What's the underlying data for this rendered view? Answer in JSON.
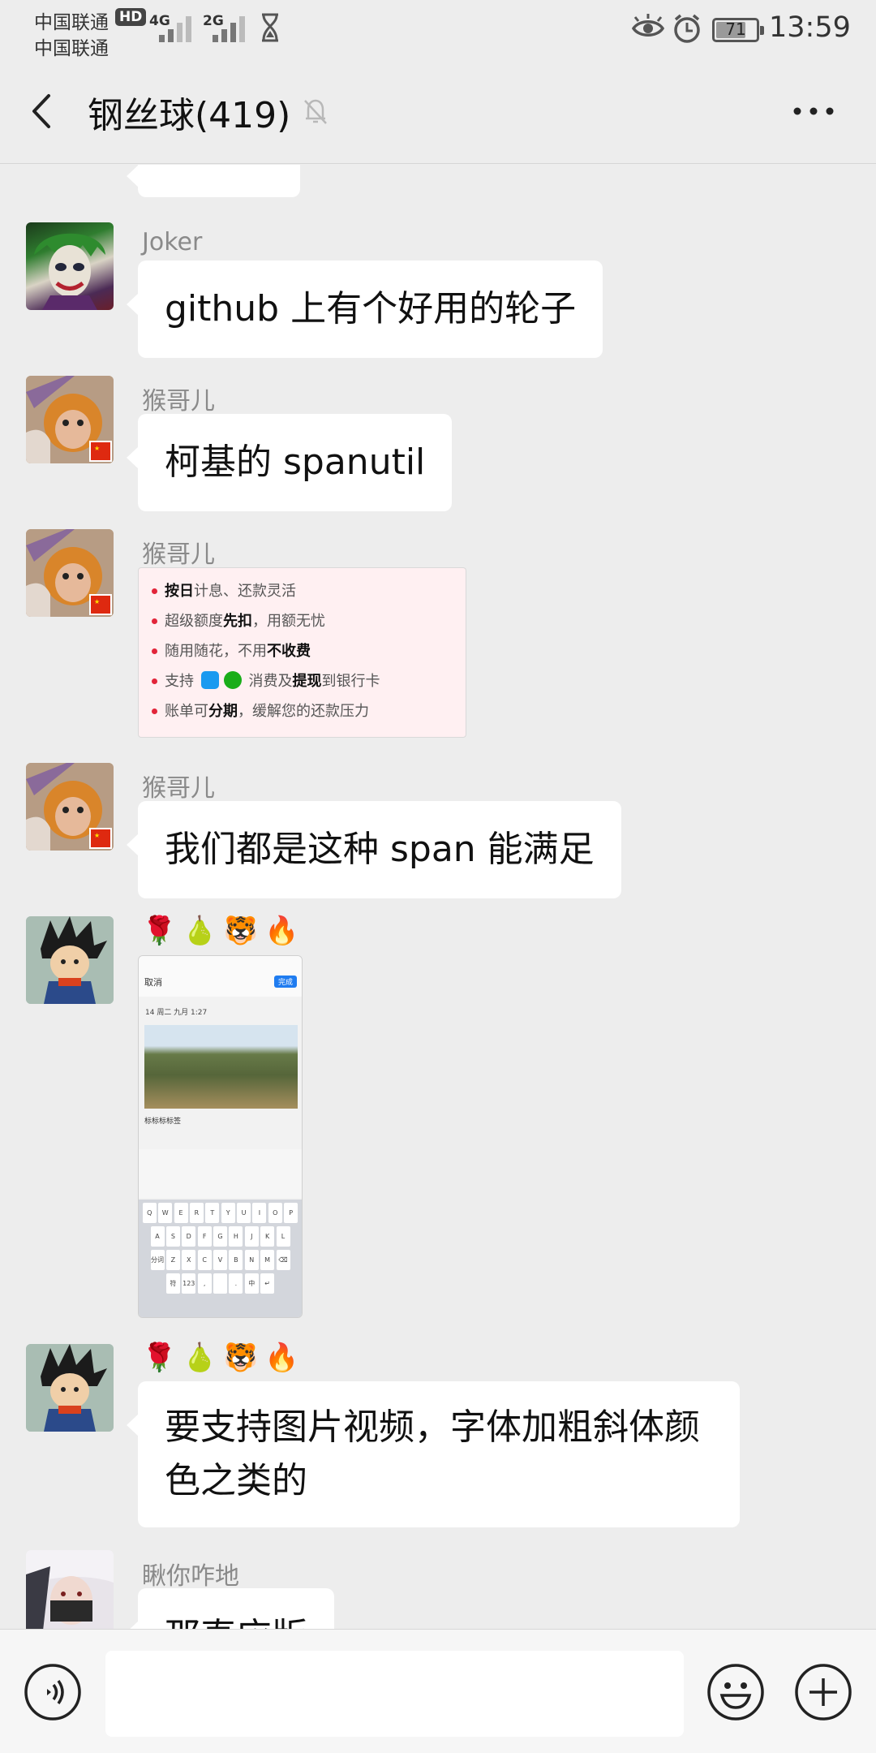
{
  "status": {
    "carrier1": "中国联通",
    "carrier2": "中国联通",
    "hd": "HD",
    "net1": "4G",
    "net2": "2G",
    "battery": "71",
    "time": "13:59"
  },
  "header": {
    "title": "钢丝球(419)"
  },
  "messages": [
    {
      "sender": "Joker",
      "text": "github 上有个好用的轮子"
    },
    {
      "sender": "猴哥儿",
      "text": "柯基的 spanutil"
    },
    {
      "sender": "猴哥儿",
      "image_lines": [
        [
          "按日",
          "计息、还款灵活"
        ],
        [
          "超级额度",
          "先扣",
          "，用额无忧"
        ],
        [
          "随用随花，不用",
          "不收费"
        ],
        [
          "支持 ",
          " 消费及",
          "提现",
          "到银行卡"
        ],
        [
          "账单可",
          "分期",
          "，缓解您的还款压力"
        ]
      ]
    },
    {
      "sender": "猴哥儿",
      "text": "我们都是这种 span 能满足"
    },
    {
      "emojis": "🌹🍐🐯🔥",
      "screenshot": {
        "title": "取消",
        "done": "完成",
        "date": "14 周二 九月 1:27",
        "note": "标标标标签"
      }
    },
    {
      "emojis": "🌹🍐🐯🔥",
      "text": "要支持图片视频，字体加粗斜体颜色之类的"
    },
    {
      "sender": "瞅你咋地",
      "text": "那直应版"
    }
  ],
  "keyboard": {
    "row1": [
      "Q",
      "W",
      "E",
      "R",
      "T",
      "Y",
      "U",
      "I",
      "O",
      "P"
    ],
    "row2": [
      "A",
      "S",
      "D",
      "F",
      "G",
      "H",
      "J",
      "K",
      "L"
    ],
    "row3": [
      "分词",
      "Z",
      "X",
      "C",
      "V",
      "B",
      "N",
      "M",
      "⌫"
    ],
    "row4": [
      "符",
      "123",
      ",",
      "  ",
      ".",
      "中",
      "↵"
    ]
  },
  "colors": {
    "background": "#ededed",
    "bubble": "#ffffff",
    "sender": "#8a8a8a",
    "accent": "#e2253a"
  },
  "icons": [
    "back-arrow-icon",
    "mute-bell-icon",
    "more-dots-icon",
    "voice-icon",
    "emoji-icon",
    "plus-icon"
  ]
}
